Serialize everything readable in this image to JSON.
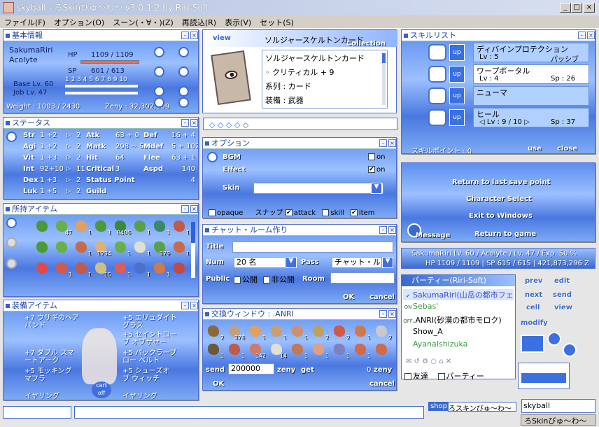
{
  "app": {
    "title": "skyball - ろSkinびゅ〜わ〜 v3.0-1.2 by Riri-Soft"
  },
  "menu": [
    "ファイル(F)",
    "オプション(O)",
    "スーン(・∀・)(Z)",
    "再読込(R)",
    "表示(V)",
    "セット(S)"
  ],
  "basic": {
    "title": "基本情報",
    "name": "SakumaRiri",
    "job": "Acolyte",
    "hp_label": "HP",
    "hp_value": "1109 / 1109",
    "sp_label": "SP",
    "sp_value": "601 / 613",
    "hp_fill": 1.0,
    "sp_fill": 0.98,
    "base_lv": "Base Lv. 60",
    "job_lv": "Job Lv. 47",
    "ticks": "1 2 3 4 5 6 7 8 9 10",
    "weight": "Weight : 1003 / 2430",
    "zeny": "Zeny : 32,302,309"
  },
  "card": {
    "view": "view",
    "collection": "Collection",
    "title": "ソルジャースケルトンカード",
    "name": "ソルジャースケルトンカード",
    "effect": "◦ クリティカル + 9",
    "type": "系列 : カード",
    "equip": "装備 : 武器"
  },
  "status": {
    "title": "ステータス",
    "rows": [
      {
        "stat": "Str",
        "val": "1 +2",
        "pts": "2",
        "k1": "Atk",
        "v1": "63 + 0",
        "k2": "Def",
        "v2": "16 + 4"
      },
      {
        "stat": "Agi",
        "val": "1 +2",
        "pts": "2",
        "k1": "Matk",
        "v1": "298 ~ 502",
        "k2": "Mdef",
        "v2": "5 + 102"
      },
      {
        "stat": "Vit",
        "val": "1 +3",
        "pts": "2",
        "k1": "Hit",
        "v1": "64",
        "k2": "Flee",
        "v2": "63 + 1"
      },
      {
        "stat": "Int",
        "val": "92+10",
        "pts": "11",
        "k1": "Critical",
        "v1": "3",
        "k2": "Aspd",
        "v2": "140"
      },
      {
        "stat": "Dex",
        "val": "1 +3",
        "pts": "2",
        "k1": "Status Point",
        "v1": "",
        "k2": "",
        "v2": "4"
      },
      {
        "stat": "Luk",
        "val": "1 +5",
        "pts": "2",
        "k1": "Guild",
        "v1": "",
        "k2": "",
        "v2": ""
      }
    ]
  },
  "skills": {
    "title": "スキルリスト",
    "items": [
      {
        "name": "ディバインプロテクション",
        "lv": "Lv : 5",
        "info": "パッシブ",
        "color": "#b0d0ff"
      },
      {
        "name": "ワープポータル",
        "lv": "Lv : 4",
        "info": "Sp : 26",
        "color": "#ffffff"
      },
      {
        "name": "ニューマ",
        "lv": "",
        "info": "",
        "color": "#b0d0ff"
      },
      {
        "name": "ヒール",
        "lv": "◁ Lv : 9 / 10 ▷",
        "info": "Sp : 37",
        "color": "#b0d0ff"
      }
    ],
    "points": "スキルポイント : 0",
    "use": "use",
    "close": "close",
    "up": "up"
  },
  "option": {
    "title": "オプション",
    "bgm": "BGM",
    "effect": "Effect",
    "on": "on",
    "skin": "Skin",
    "opaque": "opaque",
    "snap": "スナップ",
    "attack": "attack",
    "skill": "skill",
    "item": "item"
  },
  "menu_win": {
    "items": [
      "Return to last save point",
      "Character Select",
      "Exit to Windows",
      "Return to game"
    ],
    "message": "Message"
  },
  "items": {
    "title": "所持アイテム",
    "counts": [
      "",
      "47",
      "1",
      "1",
      "8406",
      "1",
      "1",
      "1",
      "",
      "",
      "1",
      "1234",
      "1",
      "1",
      "379",
      "1",
      "",
      "1",
      "1",
      "15",
      "1",
      "1",
      "1",
      ""
    ]
  },
  "chat": {
    "title": "チャット・ルーム作り",
    "title_label": "Title",
    "num_label": "Num",
    "num_value": "20 名",
    "pass_label": "Pass",
    "pass_value": "チャット・ルー",
    "public_label": "Public",
    "public_opt": "公開",
    "private_opt": "非公開",
    "room_label": "Room",
    "ok": "OK",
    "cancel": "cancel"
  },
  "char_status": {
    "line1": "SakumaRiri    Lv. 60 / Acolyte / Lv. 47 / Exp. 50 %",
    "line2": "HP 1109 / 1109 | SP 615 / 615 | 421,873,296 Z"
  },
  "party": {
    "title": "パーティー(Riri-Soft)",
    "members": [
      {
        "tag": "✔",
        "name": "SakumaRiri(山岳の都市フェ"
      },
      {
        "tag": "ON",
        "name": "Sebas'"
      },
      {
        "tag": "OFF",
        "name": ".ANRI(砂漠の都市モロク)"
      },
      {
        "tag": "",
        "name": "Show_A"
      },
      {
        "tag": "",
        "name": "AyanaIshizuka"
      }
    ],
    "friend": "友達",
    "party_label": "パーティー"
  },
  "equip": {
    "title": "装備アイテム",
    "left": [
      "+7 ウサギのヘアバンド",
      "+7 ダブル スマートアーク",
      "+5 モッキング マフラ",
      "イヤリング"
    ],
    "right": [
      "+5 エリュダイト グラス",
      "+5 セイントローブ オブザセー",
      "+5 パックラーブロー ベルト",
      "+5 シューズオ ブ ウィッチ",
      "イヤリング"
    ],
    "cart": "cart off"
  },
  "trade": {
    "title": "交換ウィンドウ : .ANRI",
    "counts": [
      "2",
      "378",
      "1",
      "1",
      "1",
      "2",
      "2",
      "1",
      "2",
      "1",
      "1",
      "142",
      "14",
      "1",
      "1",
      "1",
      "1",
      ""
    ],
    "send": "send",
    "send_val": "200000",
    "zeny": "zeny",
    "get": "get",
    "get_val": "0",
    "zeny2": "zeny",
    "ok": "OK",
    "cancel": "cancel"
  },
  "sidebtns": [
    "prev",
    "edit",
    "next",
    "send",
    "cell",
    "view",
    "modify"
  ],
  "bottom": {
    "shop": "shop",
    "skin_label": "ろスキンびゅ〜わ〜",
    "chat_name": "skyball",
    "taskbar": "ろSkinびゅ〜わ〜"
  }
}
